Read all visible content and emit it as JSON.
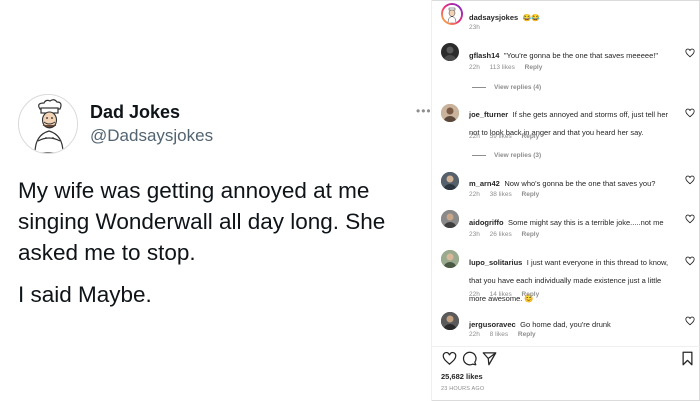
{
  "tweet": {
    "author_name": "Dad Jokes",
    "author_handle": "@Dadsaysjokes",
    "text_p1": "My wife was getting annoyed at me singing Wonderwall all day long. She asked me to stop.",
    "text_p2": "I said Maybe."
  },
  "caption": {
    "username": "dadsaysjokes",
    "emojis": "😂😂",
    "time": "23h"
  },
  "comments": [
    {
      "username": "gflash14",
      "text": "\"You're gonna be the one that saves meeeee!\"",
      "time": "22h",
      "likes": "113 likes",
      "reply": "Reply",
      "view_replies": "View replies (4)",
      "avatar_color": "#2b2b2b"
    },
    {
      "username": "joe_fturner",
      "text": "If she gets annoyed and storms off, just tell her not to look back in anger and that you heard her say.",
      "time": "22h",
      "likes": "59 likes",
      "reply": "Reply",
      "view_replies": "View replies (3)",
      "avatar_color": "#8a6a55"
    },
    {
      "username": "m_arn42",
      "text": "Now who's gonna be the one that saves you?",
      "time": "22h",
      "likes": "38 likes",
      "reply": "Reply",
      "avatar_color": "#3a4a5a"
    },
    {
      "username": "aidogriffo",
      "text": "Some might say this is a terrible joke.....not me",
      "time": "23h",
      "likes": "26 likes",
      "reply": "Reply",
      "avatar_color": "#6b6b6b"
    },
    {
      "username": "lupo_solitarius",
      "text": "I just want everyone in this thread to know, that you have each individually made existence just a little more awesome. 😊",
      "time": "22h",
      "likes": "14 likes",
      "reply": "Reply",
      "avatar_color": "#7a8a70"
    },
    {
      "username": "jergusoravec",
      "text": "Go home dad, you're drunk",
      "time": "22h",
      "likes": "8 likes",
      "reply": "Reply",
      "avatar_color": "#444"
    }
  ],
  "footer": {
    "likes": "25,682 likes",
    "posted": "23 HOURS AGO"
  },
  "more_dots": "•••",
  "colors": {
    "meta": "#8e8e8e",
    "text": "#262626",
    "handle": "#536471"
  }
}
